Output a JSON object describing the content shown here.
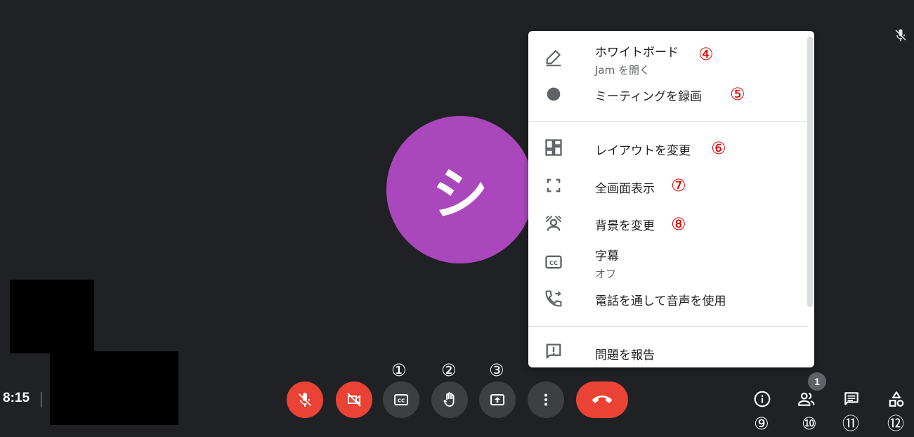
{
  "status": {
    "time": "8:15",
    "participant_count": "1",
    "avatar_initial": "シ"
  },
  "menu": {
    "items": [
      {
        "label": "ホワイトボード",
        "sub": "Jam を開く",
        "icon": "pen-icon",
        "marker": "④"
      },
      {
        "label": "ミーティングを録画",
        "icon": "record-icon",
        "marker": "⑤"
      },
      {
        "label": "レイアウトを変更",
        "icon": "layout-icon",
        "marker": "⑥"
      },
      {
        "label": "全画面表示",
        "icon": "fullscreen-icon",
        "marker": "⑦"
      },
      {
        "label": "背景を変更",
        "icon": "background-icon",
        "marker": "⑧"
      },
      {
        "label": "字幕",
        "sub": "オフ",
        "icon": "captions-icon"
      },
      {
        "label": "電話を通して音声を使用",
        "icon": "phone-forward-icon"
      },
      {
        "label": "問題を報告",
        "icon": "report-icon"
      }
    ]
  },
  "controls": {
    "markers": [
      "①",
      "②",
      "③"
    ],
    "right_markers": [
      "⑨",
      "⑩",
      "⑪",
      "⑫"
    ]
  },
  "colors": {
    "background": "#202124",
    "red": "#ea4335",
    "gray_button": "#3c4043",
    "avatar": "#ab47bc",
    "marker_red": "#e00000"
  }
}
